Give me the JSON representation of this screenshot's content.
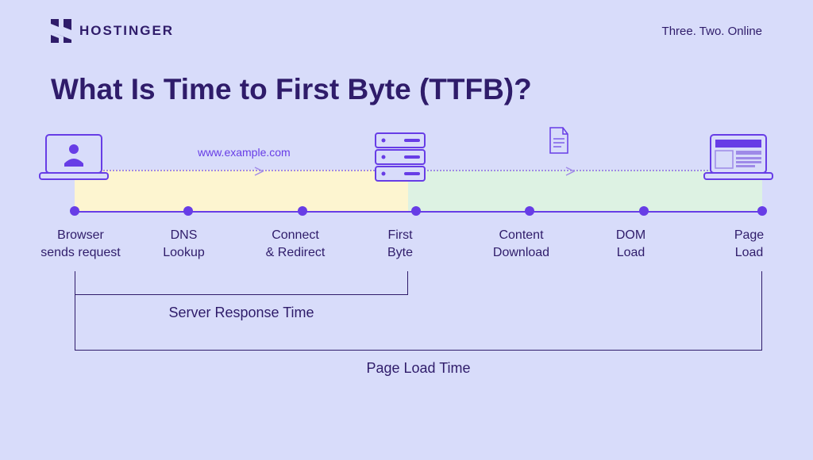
{
  "header": {
    "brand": "HOSTINGER",
    "tagline": "Three. Two. Online"
  },
  "title": "What Is Time to First Byte (TTFB)?",
  "url": "www.example.com",
  "stages": [
    "Browser\nsends request",
    "DNS\nLookup",
    "Connect\n& Redirect",
    "First\nByte",
    "Content\nDownload",
    "DOM\nLoad",
    "Page\nLoad"
  ],
  "brackets": {
    "server_response": "Server Response Time",
    "page_load": "Page Load Time"
  },
  "colors": {
    "bg": "#d8dcfa",
    "accent": "#673de6",
    "text": "#2f1c6a",
    "band_yellow": "#fdf5d0",
    "band_green": "#ddf2e3"
  }
}
